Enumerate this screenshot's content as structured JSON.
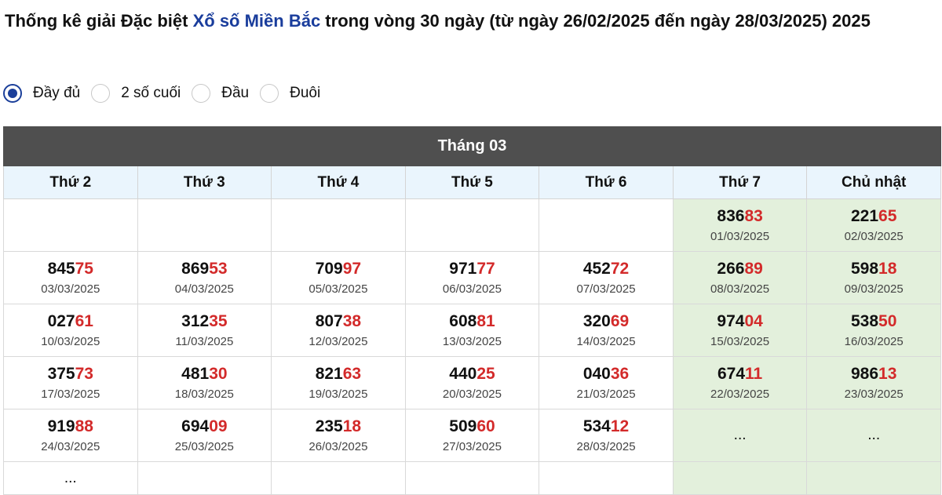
{
  "title": {
    "prefix": "Thống kê giải Đặc biệt ",
    "link": "Xổ số Miền Bắc",
    "suffix": " trong vòng 30 ngày (từ ngày 26/02/2025 đến ngày 28/03/2025) 2025"
  },
  "radios": [
    {
      "label": "Đầy đủ",
      "selected": true
    },
    {
      "label": "2 số cuối",
      "selected": false
    },
    {
      "label": "Đầu",
      "selected": false
    },
    {
      "label": "Đuôi",
      "selected": false
    }
  ],
  "table": {
    "month": "Tháng 03",
    "days": [
      "Thứ 2",
      "Thứ 3",
      "Thứ 4",
      "Thứ 5",
      "Thứ 6",
      "Thứ 7",
      "Chủ nhật"
    ],
    "rows": [
      [
        null,
        null,
        null,
        null,
        null,
        {
          "prefix": "836",
          "last2": "83",
          "date": "01/03/2025"
        },
        {
          "prefix": "221",
          "last2": "65",
          "date": "02/03/2025"
        }
      ],
      [
        {
          "prefix": "845",
          "last2": "75",
          "date": "03/03/2025"
        },
        {
          "prefix": "869",
          "last2": "53",
          "date": "04/03/2025"
        },
        {
          "prefix": "709",
          "last2": "97",
          "date": "05/03/2025"
        },
        {
          "prefix": "971",
          "last2": "77",
          "date": "06/03/2025"
        },
        {
          "prefix": "452",
          "last2": "72",
          "date": "07/03/2025"
        },
        {
          "prefix": "266",
          "last2": "89",
          "date": "08/03/2025"
        },
        {
          "prefix": "598",
          "last2": "18",
          "date": "09/03/2025"
        }
      ],
      [
        {
          "prefix": "027",
          "last2": "61",
          "date": "10/03/2025"
        },
        {
          "prefix": "312",
          "last2": "35",
          "date": "11/03/2025"
        },
        {
          "prefix": "807",
          "last2": "38",
          "date": "12/03/2025"
        },
        {
          "prefix": "608",
          "last2": "81",
          "date": "13/03/2025"
        },
        {
          "prefix": "320",
          "last2": "69",
          "date": "14/03/2025"
        },
        {
          "prefix": "974",
          "last2": "04",
          "date": "15/03/2025"
        },
        {
          "prefix": "538",
          "last2": "50",
          "date": "16/03/2025"
        }
      ],
      [
        {
          "prefix": "375",
          "last2": "73",
          "date": "17/03/2025"
        },
        {
          "prefix": "481",
          "last2": "30",
          "date": "18/03/2025"
        },
        {
          "prefix": "821",
          "last2": "63",
          "date": "19/03/2025"
        },
        {
          "prefix": "440",
          "last2": "25",
          "date": "20/03/2025"
        },
        {
          "prefix": "040",
          "last2": "36",
          "date": "21/03/2025"
        },
        {
          "prefix": "674",
          "last2": "11",
          "date": "22/03/2025"
        },
        {
          "prefix": "986",
          "last2": "13",
          "date": "23/03/2025"
        }
      ],
      [
        {
          "prefix": "919",
          "last2": "88",
          "date": "24/03/2025"
        },
        {
          "prefix": "694",
          "last2": "09",
          "date": "25/03/2025"
        },
        {
          "prefix": "235",
          "last2": "18",
          "date": "26/03/2025"
        },
        {
          "prefix": "509",
          "last2": "60",
          "date": "27/03/2025"
        },
        {
          "prefix": "534",
          "last2": "12",
          "date": "28/03/2025"
        },
        {
          "placeholder": "..."
        },
        {
          "placeholder": "..."
        }
      ],
      [
        {
          "placeholder": "..."
        },
        null,
        null,
        null,
        null,
        null,
        null
      ]
    ]
  },
  "colors": {
    "title_link": "#1a3d9c",
    "highlight_digits": "#d32a2a",
    "month_header_bg": "#4f4f4f",
    "day_header_bg": "#eaf5fd",
    "weekend_bg": "#e3f0dc",
    "radio_selected": "#1b3f9a"
  }
}
